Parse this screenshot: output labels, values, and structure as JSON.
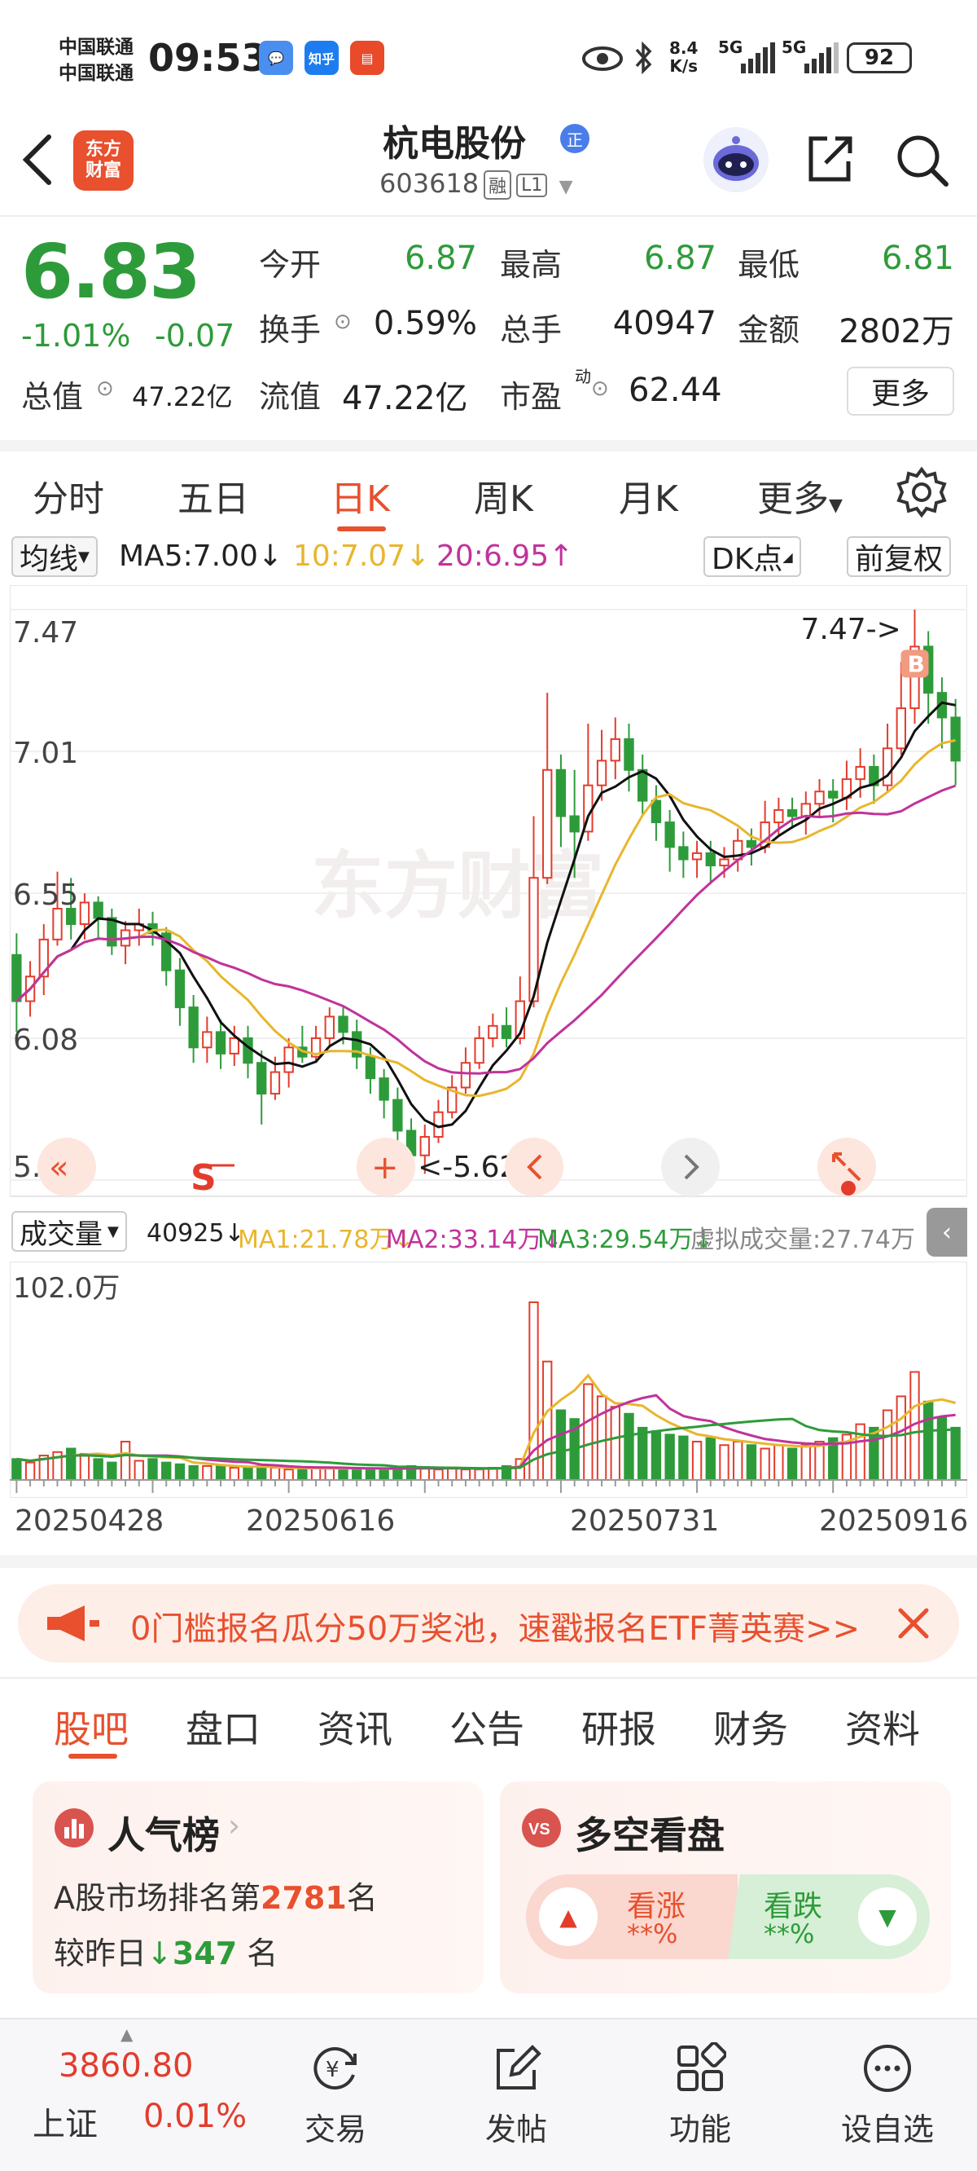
{
  "status": {
    "carrier1": "中国联通",
    "carrier2": "中国联通",
    "time": "09:53",
    "app1": "💬",
    "app2": "知乎",
    "net_speed_value": "8.4",
    "net_speed_unit": "K/s",
    "signal1": "5G",
    "signal2": "5G",
    "battery": "92"
  },
  "header": {
    "logo_line1": "东方",
    "logo_line2": "财富",
    "stock_name": "杭电股份",
    "badge": "正",
    "stock_code": "603618",
    "tag1": "融",
    "tag2": "L1"
  },
  "quote": {
    "price": "6.83",
    "change_pct": "-1.01%",
    "change_abs": "-0.07",
    "open_label": "今开",
    "open": "6.87",
    "high_label": "最高",
    "high": "6.87",
    "low_label": "最低",
    "low": "6.81",
    "turnover_label": "换手",
    "turnover": "0.59%",
    "volume_label": "总手",
    "volume": "40947",
    "amount_label": "金额",
    "amount": "2802万",
    "mktcap_label": "总值",
    "mktcap": "47.22亿",
    "float_label": "流值",
    "float": "47.22亿",
    "pe_label": "市盈",
    "pe_sup": "动",
    "pe": "62.44",
    "more": "更多"
  },
  "period_tabs": [
    "分时",
    "五日",
    "日K",
    "周K",
    "月K",
    "更多"
  ],
  "ma_legend": {
    "type": "均线",
    "ma5": "MA5:7.00↓",
    "ma10": "10:7.07↓",
    "ma20": "20:6.95↑",
    "dk": "DK点",
    "adjust": "前复权"
  },
  "kchart": {
    "y_labels": [
      "7.47",
      "7.01",
      "6.55",
      "6.08",
      "5.62"
    ],
    "max_label": "7.47->",
    "min_label": "<-5.62",
    "watermark": "东方财富",
    "marker_s": "S",
    "marker_b": "B"
  },
  "volume": {
    "type": "成交量",
    "vol": "40925↓",
    "ma1": "MA1:21.78万↓",
    "ma2": "MA2:33.14万↓",
    "ma3": "MA3:29.54万↓",
    "virtual": "虚拟成交量:27.74万",
    "max_label": "102.0万"
  },
  "dates": [
    "20250428",
    "20250616",
    "20250731",
    "20250916"
  ],
  "promo": {
    "text": "0门槛报名瓜分50万奖池，速戳报名ETF菁英赛>>"
  },
  "content_tabs": [
    "股吧",
    "盘口",
    "资讯",
    "公告",
    "研报",
    "财务",
    "资料"
  ],
  "popularity": {
    "title": "人气榜",
    "rank_prefix": "A股市场排名第",
    "rank": "2781",
    "rank_suffix": "名",
    "compare_prefix": "较昨日",
    "compare_value": "347",
    "compare_suffix": "名"
  },
  "bullbear": {
    "title": "多空看盘",
    "bull_label": "看涨",
    "bull_pct": "**%",
    "bear_label": "看跌",
    "bear_pct": "**%"
  },
  "bottom": {
    "index_value": "3860.80",
    "index_name": "上证",
    "index_change": "0.01%",
    "items": [
      "交易",
      "发帖",
      "功能",
      "设自选"
    ]
  },
  "colors": {
    "green": "#2e9b3a",
    "red": "#e33c2d",
    "accent": "#e8502e",
    "ma5": "#111111",
    "ma10": "#e8b62e",
    "ma20": "#c0339c"
  },
  "chart_data": {
    "type": "candlestick",
    "price_range": [
      5.62,
      7.47
    ],
    "annotations": {
      "high": 7.47,
      "low": 5.62
    },
    "candles": [
      [
        6.35,
        6.2,
        6.42,
        6.1
      ],
      [
        6.2,
        6.28,
        6.33,
        6.15
      ],
      [
        6.28,
        6.4,
        6.45,
        6.22
      ],
      [
        6.4,
        6.5,
        6.62,
        6.38
      ],
      [
        6.5,
        6.45,
        6.6,
        6.4
      ],
      [
        6.45,
        6.52,
        6.55,
        6.4
      ],
      [
        6.52,
        6.47,
        6.54,
        6.4
      ],
      [
        6.47,
        6.38,
        6.5,
        6.35
      ],
      [
        6.38,
        6.43,
        6.46,
        6.32
      ],
      [
        6.43,
        6.45,
        6.5,
        6.38
      ],
      [
        6.45,
        6.42,
        6.49,
        6.38
      ],
      [
        6.42,
        6.3,
        6.44,
        6.25
      ],
      [
        6.3,
        6.18,
        6.34,
        6.12
      ],
      [
        6.18,
        6.05,
        6.22,
        6.0
      ],
      [
        6.05,
        6.1,
        6.15,
        6.0
      ],
      [
        6.1,
        6.03,
        6.14,
        5.98
      ],
      [
        6.03,
        6.08,
        6.12,
        5.99
      ],
      [
        6.08,
        6.0,
        6.12,
        5.95
      ],
      [
        6.0,
        5.9,
        6.04,
        5.8
      ],
      [
        5.9,
        5.97,
        6.02,
        5.88
      ],
      [
        5.97,
        6.05,
        6.08,
        5.92
      ],
      [
        6.05,
        6.02,
        6.12,
        6.0
      ],
      [
        6.02,
        6.08,
        6.12,
        6.0
      ],
      [
        6.08,
        6.15,
        6.18,
        6.05
      ],
      [
        6.15,
        6.1,
        6.18,
        6.06
      ],
      [
        6.1,
        6.02,
        6.14,
        5.98
      ],
      [
        6.02,
        5.95,
        6.05,
        5.9
      ],
      [
        5.95,
        5.88,
        5.98,
        5.82
      ],
      [
        5.88,
        5.78,
        5.92,
        5.72
      ],
      [
        5.78,
        5.7,
        5.82,
        5.62
      ],
      [
        5.7,
        5.76,
        5.8,
        5.64
      ],
      [
        5.76,
        5.84,
        5.88,
        5.74
      ],
      [
        5.84,
        5.92,
        5.96,
        5.82
      ],
      [
        5.92,
        6.0,
        6.05,
        5.9
      ],
      [
        6.0,
        6.08,
        6.12,
        5.98
      ],
      [
        6.08,
        6.12,
        6.16,
        6.05
      ],
      [
        6.12,
        6.08,
        6.18,
        6.05
      ],
      [
        6.08,
        6.2,
        6.28,
        6.06
      ],
      [
        6.2,
        6.6,
        6.8,
        6.18
      ],
      [
        6.6,
        6.95,
        7.2,
        6.58
      ],
      [
        6.95,
        6.8,
        7.0,
        6.7
      ],
      [
        6.8,
        6.75,
        6.95,
        6.6
      ],
      [
        6.75,
        6.9,
        7.1,
        6.72
      ],
      [
        6.9,
        6.98,
        7.08,
        6.85
      ],
      [
        6.98,
        7.05,
        7.12,
        6.92
      ],
      [
        7.05,
        6.95,
        7.1,
        6.88
      ],
      [
        6.95,
        6.85,
        7.0,
        6.8
      ],
      [
        6.85,
        6.78,
        6.9,
        6.72
      ],
      [
        6.78,
        6.7,
        6.82,
        6.62
      ],
      [
        6.7,
        6.66,
        6.75,
        6.6
      ],
      [
        6.66,
        6.68,
        6.72,
        6.6
      ],
      [
        6.68,
        6.64,
        6.72,
        6.58
      ],
      [
        6.64,
        6.66,
        6.7,
        6.6
      ],
      [
        6.66,
        6.72,
        6.76,
        6.62
      ],
      [
        6.72,
        6.7,
        6.76,
        6.64
      ],
      [
        6.7,
        6.78,
        6.85,
        6.68
      ],
      [
        6.78,
        6.82,
        6.86,
        6.74
      ],
      [
        6.82,
        6.8,
        6.86,
        6.76
      ],
      [
        6.8,
        6.84,
        6.88,
        6.74
      ],
      [
        6.84,
        6.88,
        6.92,
        6.8
      ],
      [
        6.88,
        6.86,
        6.92,
        6.78
      ],
      [
        6.86,
        6.92,
        6.98,
        6.82
      ],
      [
        6.92,
        6.96,
        7.02,
        6.86
      ],
      [
        6.96,
        6.9,
        7.0,
        6.84
      ],
      [
        6.9,
        7.02,
        7.1,
        6.88
      ],
      [
        7.02,
        7.15,
        7.3,
        7.0
      ],
      [
        7.15,
        7.35,
        7.47,
        7.1
      ],
      [
        7.35,
        7.2,
        7.4,
        7.1
      ],
      [
        7.2,
        7.12,
        7.25,
        7.02
      ],
      [
        7.12,
        6.98,
        7.18,
        6.9
      ]
    ],
    "volume_max": 102.0,
    "volume_unit": "万",
    "volumes": [
      12,
      10,
      14,
      16,
      18,
      15,
      12,
      10,
      22,
      11,
      12,
      10,
      9,
      8,
      8,
      8,
      7,
      7,
      8,
      7,
      6,
      6,
      7,
      7,
      7,
      6,
      6,
      6,
      7,
      8,
      7,
      6,
      7,
      6,
      6,
      7,
      8,
      12,
      102,
      68,
      40,
      35,
      55,
      48,
      42,
      38,
      30,
      28,
      26,
      25,
      22,
      24,
      20,
      22,
      20,
      18,
      20,
      18,
      20,
      22,
      24,
      26,
      32,
      30,
      40,
      48,
      62,
      45,
      36,
      30
    ]
  }
}
